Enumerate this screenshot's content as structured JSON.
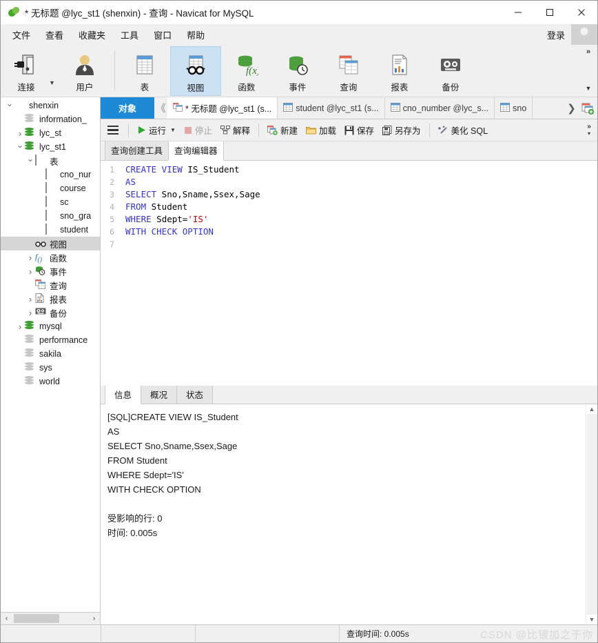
{
  "window": {
    "title": "* 无标题 @lyc_st1 (shenxin) - 查询 - Navicat for MySQL",
    "logo_icon": "navicat-leaf-logo",
    "minimize_icon": "minimize-icon",
    "maximize_icon": "maximize-icon",
    "close_icon": "close-icon"
  },
  "menubar": {
    "items": [
      {
        "label": "文件"
      },
      {
        "label": "查看"
      },
      {
        "label": "收藏夹"
      },
      {
        "label": "工具"
      },
      {
        "label": "窗口"
      },
      {
        "label": "帮助"
      }
    ],
    "login_label": "登录",
    "avatar_icon": "user-avatar-icon"
  },
  "toolbar": {
    "groups": [
      {
        "buttons": [
          {
            "label": "连接",
            "icon": "connection-icon",
            "selected": false,
            "has_dropdown": true
          },
          {
            "label": "用户",
            "icon": "user-icon",
            "selected": false,
            "has_dropdown": false
          }
        ]
      },
      {
        "buttons": [
          {
            "label": "表",
            "icon": "table-icon",
            "selected": false,
            "has_dropdown": false
          },
          {
            "label": "视图",
            "icon": "view-glasses-icon",
            "selected": true,
            "has_dropdown": false
          },
          {
            "label": "函数",
            "icon": "function-icon",
            "selected": false,
            "has_dropdown": false
          },
          {
            "label": "事件",
            "icon": "event-clock-icon",
            "selected": false,
            "has_dropdown": false
          },
          {
            "label": "查询",
            "icon": "query-icon",
            "selected": false,
            "has_dropdown": false
          },
          {
            "label": "报表",
            "icon": "report-icon",
            "selected": false,
            "has_dropdown": false
          },
          {
            "label": "备份",
            "icon": "backup-icon",
            "selected": false,
            "has_dropdown": false
          }
        ]
      }
    ],
    "overflow_icon": "chevron-double-right-icon",
    "overflow_more_icon": "chevron-down-icon"
  },
  "sidebar": {
    "tree": [
      {
        "label": "shenxin",
        "depth": 0,
        "icon": "connection-icon",
        "twisty": "open",
        "selected": false
      },
      {
        "label": "information_",
        "depth": 1,
        "icon": "database-grey-icon",
        "twisty": "none",
        "selected": false
      },
      {
        "label": "lyc_st",
        "depth": 1,
        "icon": "database-green-icon",
        "twisty": "closed",
        "selected": false
      },
      {
        "label": "lyc_st1",
        "depth": 1,
        "icon": "database-green-icon",
        "twisty": "open",
        "selected": false
      },
      {
        "label": "表",
        "depth": 2,
        "icon": "table-icon",
        "twisty": "open",
        "selected": false
      },
      {
        "label": "cno_nur",
        "depth": 3,
        "icon": "table-icon",
        "twisty": "none",
        "selected": false
      },
      {
        "label": "course",
        "depth": 3,
        "icon": "table-icon",
        "twisty": "none",
        "selected": false
      },
      {
        "label": "sc",
        "depth": 3,
        "icon": "table-icon",
        "twisty": "none",
        "selected": false
      },
      {
        "label": "sno_gra",
        "depth": 3,
        "icon": "table-icon",
        "twisty": "none",
        "selected": false
      },
      {
        "label": "student",
        "depth": 3,
        "icon": "table-icon",
        "twisty": "none",
        "selected": false
      },
      {
        "label": "视图",
        "depth": 2,
        "icon": "view-glasses-icon",
        "twisty": "none",
        "selected": true
      },
      {
        "label": "函数",
        "depth": 2,
        "icon": "function-icon",
        "twisty": "closed",
        "selected": false
      },
      {
        "label": "事件",
        "depth": 2,
        "icon": "event-clock-icon",
        "twisty": "closed",
        "selected": false
      },
      {
        "label": "查询",
        "depth": 2,
        "icon": "query-icon",
        "twisty": "none",
        "selected": false
      },
      {
        "label": "报表",
        "depth": 2,
        "icon": "report-icon",
        "twisty": "closed",
        "selected": false
      },
      {
        "label": "备份",
        "depth": 2,
        "icon": "backup-icon",
        "twisty": "closed",
        "selected": false
      },
      {
        "label": "mysql",
        "depth": 1,
        "icon": "database-green-icon",
        "twisty": "closed",
        "selected": false
      },
      {
        "label": "performance",
        "depth": 1,
        "icon": "database-grey-icon",
        "twisty": "none",
        "selected": false
      },
      {
        "label": "sakila",
        "depth": 1,
        "icon": "database-grey-icon",
        "twisty": "none",
        "selected": false
      },
      {
        "label": "sys",
        "depth": 1,
        "icon": "database-grey-icon",
        "twisty": "none",
        "selected": false
      },
      {
        "label": "world",
        "depth": 1,
        "icon": "database-grey-icon",
        "twisty": "none",
        "selected": false
      }
    ],
    "hscroll_left_icon": "chevron-left-icon",
    "hscroll_right_icon": "chevron-right-icon"
  },
  "tabbar": {
    "object_label": "对象",
    "nav_left_icon": "chevron-double-left-icon",
    "nav_right_icon": "chevron-right-icon",
    "add_tab_icon": "new-query-tab-icon",
    "tabs": [
      {
        "label": "* 无标题 @lyc_st1 (s...",
        "icon": "query-icon",
        "active": true
      },
      {
        "label": "student @lyc_st1 (s...",
        "icon": "table-icon",
        "active": false
      },
      {
        "label": "cno_number @lyc_s...",
        "icon": "table-icon",
        "active": false
      },
      {
        "label": "sno",
        "icon": "table-icon",
        "active": false
      }
    ]
  },
  "query_toolbar": {
    "menu_icon": "hamburger-menu-icon",
    "buttons": [
      {
        "label": "运行",
        "icon": "play-icon",
        "disabled": false,
        "has_dropdown": true
      },
      {
        "label": "停止",
        "icon": "stop-icon",
        "disabled": true,
        "has_dropdown": false
      },
      {
        "label": "解释",
        "icon": "explain-icon",
        "disabled": false,
        "has_dropdown": false
      },
      {
        "label": "新建",
        "icon": "new-icon",
        "disabled": false,
        "has_dropdown": false
      },
      {
        "label": "加载",
        "icon": "open-folder-icon",
        "disabled": false,
        "has_dropdown": false
      },
      {
        "label": "保存",
        "icon": "save-disk-icon",
        "disabled": false,
        "has_dropdown": false
      },
      {
        "label": "另存为",
        "icon": "save-as-icon",
        "disabled": false,
        "has_dropdown": false
      },
      {
        "label": "美化 SQL",
        "icon": "beautify-wand-icon",
        "disabled": false,
        "has_dropdown": false
      }
    ],
    "overflow_icon": "chevron-double-right-icon",
    "overflow_more_icon": "chevron-down-icon"
  },
  "subtabs": [
    {
      "label": "查询创建工具",
      "active": false
    },
    {
      "label": "查询编辑器",
      "active": true
    }
  ],
  "editor": {
    "line_numbers": [
      "1",
      "2",
      "3",
      "4",
      "5",
      "6",
      "7"
    ],
    "lines": [
      [
        {
          "t": "CREATE VIEW",
          "c": "kw"
        },
        {
          "t": " IS_Student",
          "c": ""
        }
      ],
      [
        {
          "t": "AS",
          "c": "kw"
        }
      ],
      [
        {
          "t": "SELECT",
          "c": "kw"
        },
        {
          "t": " Sno,Sname,Ssex,Sage",
          "c": ""
        }
      ],
      [
        {
          "t": "FROM",
          "c": "kw"
        },
        {
          "t": " Student",
          "c": ""
        }
      ],
      [
        {
          "t": "WHERE",
          "c": "kw"
        },
        {
          "t": " Sdept=",
          "c": ""
        },
        {
          "t": "'IS'",
          "c": "str"
        }
      ],
      [
        {
          "t": "WITH CHECK OPTION",
          "c": "kw"
        }
      ],
      [
        {
          "t": "",
          "c": ""
        }
      ]
    ]
  },
  "info_panel": {
    "tabs": [
      {
        "label": "信息",
        "active": true
      },
      {
        "label": "概况",
        "active": false
      },
      {
        "label": "状态",
        "active": false
      }
    ],
    "log": "[SQL]CREATE VIEW IS_Student\nAS\nSELECT Sno,Sname,Ssex,Sage\nFROM Student\nWHERE Sdept='IS'\nWITH CHECK OPTION\n\n受影响的行: 0\n时间: 0.005s",
    "scroll_up_icon": "chevron-up-icon",
    "scroll_down_icon": "chevron-down-icon"
  },
  "statusbar": {
    "query_time_label": "查询时间: 0.005s",
    "watermark": "CSDN @比镀加之于你"
  },
  "colors": {
    "accent_blue": "#1e8ad6",
    "selected_toolbar": "#cce0f4",
    "keyword": "#3333cc",
    "string": "#cc0000",
    "chrome": "#f0f0f0"
  }
}
